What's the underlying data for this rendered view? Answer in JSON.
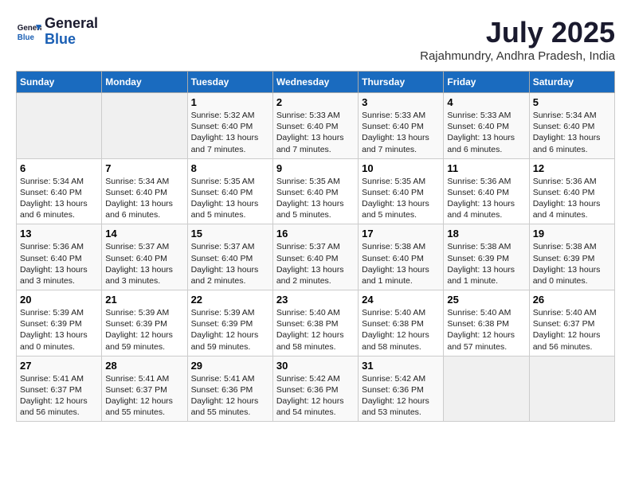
{
  "header": {
    "logo_line1": "General",
    "logo_line2": "Blue",
    "month_title": "July 2025",
    "subtitle": "Rajahmundry, Andhra Pradesh, India"
  },
  "weekdays": [
    "Sunday",
    "Monday",
    "Tuesday",
    "Wednesday",
    "Thursday",
    "Friday",
    "Saturday"
  ],
  "weeks": [
    [
      {
        "day": "",
        "info": ""
      },
      {
        "day": "",
        "info": ""
      },
      {
        "day": "1",
        "info": "Sunrise: 5:32 AM\nSunset: 6:40 PM\nDaylight: 13 hours\nand 7 minutes."
      },
      {
        "day": "2",
        "info": "Sunrise: 5:33 AM\nSunset: 6:40 PM\nDaylight: 13 hours\nand 7 minutes."
      },
      {
        "day": "3",
        "info": "Sunrise: 5:33 AM\nSunset: 6:40 PM\nDaylight: 13 hours\nand 7 minutes."
      },
      {
        "day": "4",
        "info": "Sunrise: 5:33 AM\nSunset: 6:40 PM\nDaylight: 13 hours\nand 6 minutes."
      },
      {
        "day": "5",
        "info": "Sunrise: 5:34 AM\nSunset: 6:40 PM\nDaylight: 13 hours\nand 6 minutes."
      }
    ],
    [
      {
        "day": "6",
        "info": "Sunrise: 5:34 AM\nSunset: 6:40 PM\nDaylight: 13 hours\nand 6 minutes."
      },
      {
        "day": "7",
        "info": "Sunrise: 5:34 AM\nSunset: 6:40 PM\nDaylight: 13 hours\nand 6 minutes."
      },
      {
        "day": "8",
        "info": "Sunrise: 5:35 AM\nSunset: 6:40 PM\nDaylight: 13 hours\nand 5 minutes."
      },
      {
        "day": "9",
        "info": "Sunrise: 5:35 AM\nSunset: 6:40 PM\nDaylight: 13 hours\nand 5 minutes."
      },
      {
        "day": "10",
        "info": "Sunrise: 5:35 AM\nSunset: 6:40 PM\nDaylight: 13 hours\nand 5 minutes."
      },
      {
        "day": "11",
        "info": "Sunrise: 5:36 AM\nSunset: 6:40 PM\nDaylight: 13 hours\nand 4 minutes."
      },
      {
        "day": "12",
        "info": "Sunrise: 5:36 AM\nSunset: 6:40 PM\nDaylight: 13 hours\nand 4 minutes."
      }
    ],
    [
      {
        "day": "13",
        "info": "Sunrise: 5:36 AM\nSunset: 6:40 PM\nDaylight: 13 hours\nand 3 minutes."
      },
      {
        "day": "14",
        "info": "Sunrise: 5:37 AM\nSunset: 6:40 PM\nDaylight: 13 hours\nand 3 minutes."
      },
      {
        "day": "15",
        "info": "Sunrise: 5:37 AM\nSunset: 6:40 PM\nDaylight: 13 hours\nand 2 minutes."
      },
      {
        "day": "16",
        "info": "Sunrise: 5:37 AM\nSunset: 6:40 PM\nDaylight: 13 hours\nand 2 minutes."
      },
      {
        "day": "17",
        "info": "Sunrise: 5:38 AM\nSunset: 6:40 PM\nDaylight: 13 hours\nand 1 minute."
      },
      {
        "day": "18",
        "info": "Sunrise: 5:38 AM\nSunset: 6:39 PM\nDaylight: 13 hours\nand 1 minute."
      },
      {
        "day": "19",
        "info": "Sunrise: 5:38 AM\nSunset: 6:39 PM\nDaylight: 13 hours\nand 0 minutes."
      }
    ],
    [
      {
        "day": "20",
        "info": "Sunrise: 5:39 AM\nSunset: 6:39 PM\nDaylight: 13 hours\nand 0 minutes."
      },
      {
        "day": "21",
        "info": "Sunrise: 5:39 AM\nSunset: 6:39 PM\nDaylight: 12 hours\nand 59 minutes."
      },
      {
        "day": "22",
        "info": "Sunrise: 5:39 AM\nSunset: 6:39 PM\nDaylight: 12 hours\nand 59 minutes."
      },
      {
        "day": "23",
        "info": "Sunrise: 5:40 AM\nSunset: 6:38 PM\nDaylight: 12 hours\nand 58 minutes."
      },
      {
        "day": "24",
        "info": "Sunrise: 5:40 AM\nSunset: 6:38 PM\nDaylight: 12 hours\nand 58 minutes."
      },
      {
        "day": "25",
        "info": "Sunrise: 5:40 AM\nSunset: 6:38 PM\nDaylight: 12 hours\nand 57 minutes."
      },
      {
        "day": "26",
        "info": "Sunrise: 5:40 AM\nSunset: 6:37 PM\nDaylight: 12 hours\nand 56 minutes."
      }
    ],
    [
      {
        "day": "27",
        "info": "Sunrise: 5:41 AM\nSunset: 6:37 PM\nDaylight: 12 hours\nand 56 minutes."
      },
      {
        "day": "28",
        "info": "Sunrise: 5:41 AM\nSunset: 6:37 PM\nDaylight: 12 hours\nand 55 minutes."
      },
      {
        "day": "29",
        "info": "Sunrise: 5:41 AM\nSunset: 6:36 PM\nDaylight: 12 hours\nand 55 minutes."
      },
      {
        "day": "30",
        "info": "Sunrise: 5:42 AM\nSunset: 6:36 PM\nDaylight: 12 hours\nand 54 minutes."
      },
      {
        "day": "31",
        "info": "Sunrise: 5:42 AM\nSunset: 6:36 PM\nDaylight: 12 hours\nand 53 minutes."
      },
      {
        "day": "",
        "info": ""
      },
      {
        "day": "",
        "info": ""
      }
    ]
  ]
}
